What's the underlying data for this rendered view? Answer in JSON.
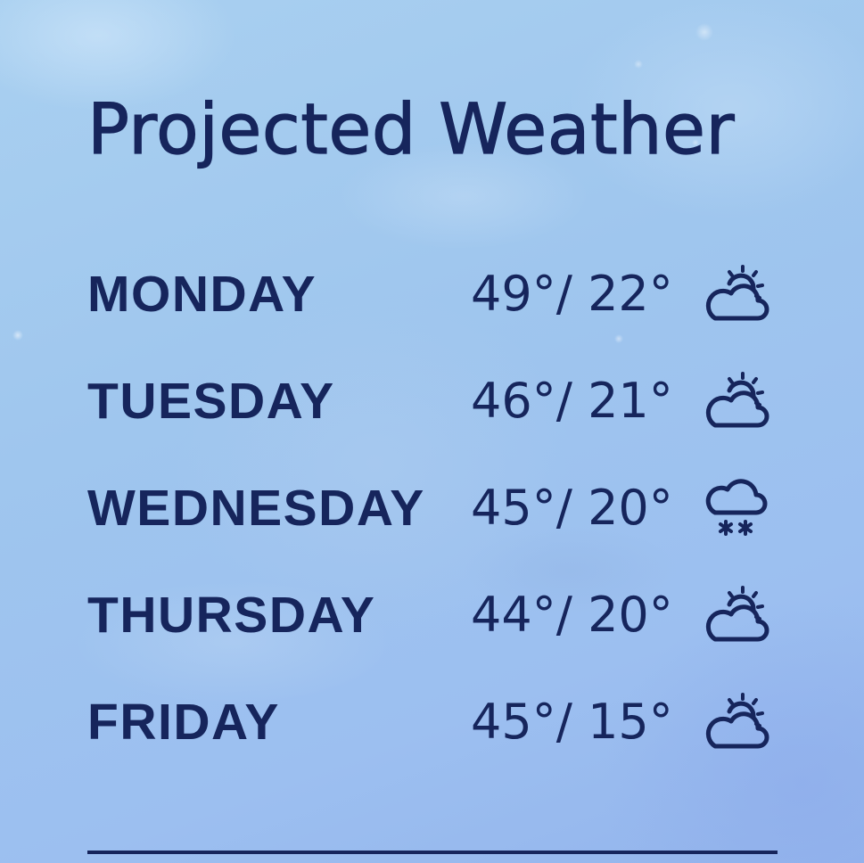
{
  "title": "Projected Weather",
  "colors": {
    "text": "#16255c",
    "background": "#a3c8ee"
  },
  "forecast": [
    {
      "day": "MONDAY",
      "temps": "49°/ 22°",
      "icon": "partly-cloudy-icon"
    },
    {
      "day": "TUESDAY",
      "temps": "46°/ 21°",
      "icon": "partly-cloudy-icon"
    },
    {
      "day": "WEDNESDAY",
      "temps": "45°/ 20°",
      "icon": "snow-cloud-icon"
    },
    {
      "day": "THURSDAY",
      "temps": "44°/ 20°",
      "icon": "partly-cloudy-icon"
    },
    {
      "day": "FRIDAY",
      "temps": "45°/ 15°",
      "icon": "partly-cloudy-icon"
    }
  ]
}
